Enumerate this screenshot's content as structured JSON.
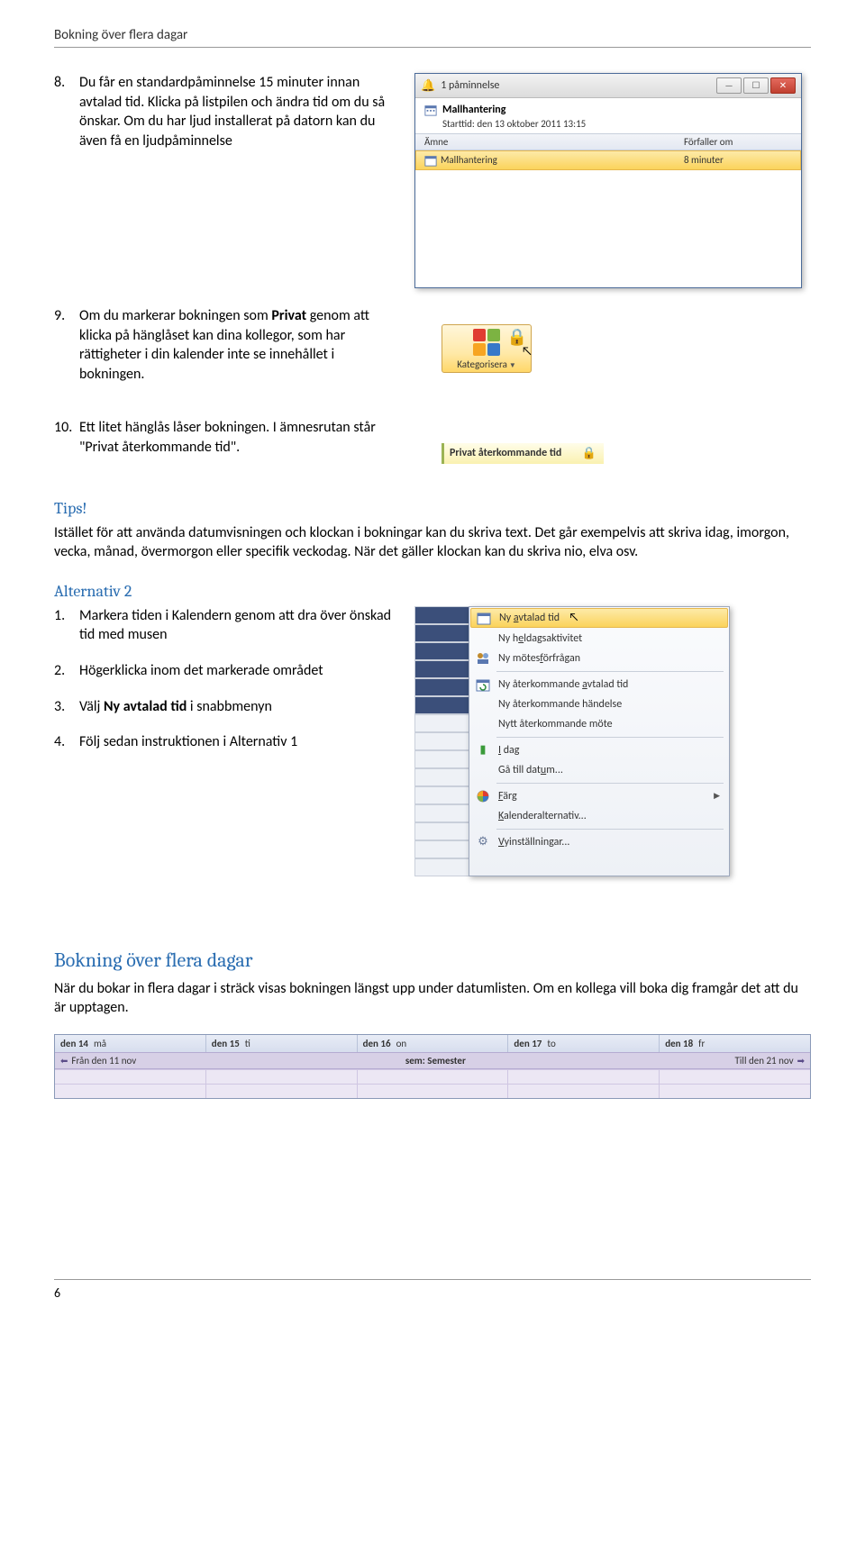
{
  "header": {
    "title": "Bokning över flera dagar"
  },
  "list8": {
    "num": "8.",
    "text_a": "Du får en standardpåminnelse 15 minuter innan avtalad tid. Klicka på listpilen och ändra tid om du så önskar. Om du har ljud installerat på datorn kan du även få en ljudpåminnelse"
  },
  "list9": {
    "num": "9.",
    "before": "Om du markerar bokningen som ",
    "bold": "Privat",
    "after": " genom att klicka på hänglåset kan dina kollegor, som har rättigheter i din kalender inte se innehållet i bokningen."
  },
  "list10": {
    "num": "10.",
    "text": "Ett litet hänglås låser bokningen. I ämnesrutan står \"Privat återkommande tid\"."
  },
  "tips": {
    "heading": "Tips!",
    "body": "Istället för att använda datumvisningen och klockan i bokningar kan du skriva text. Det går exempelvis att skriva idag, imorgon, vecka, månad, övermorgon eller specifik veckodag. När det gäller klockan kan du skriva nio, elva osv."
  },
  "alt2": {
    "heading": "Alternativ 2",
    "i1n": "1.",
    "i1": "Markera tiden i Kalendern genom att dra över önskad tid med musen",
    "i2n": "2.",
    "i2": "Högerklicka inom det markerade området",
    "i3n": "3.",
    "i3a": "Välj ",
    "i3b": "Ny avtalad tid",
    "i3c": " i snabbmenyn",
    "i4n": "4.",
    "i4": "Följ sedan instruktionen i Alternativ 1"
  },
  "section2": {
    "heading": "Bokning över flera dagar",
    "body": "När du bokar in flera dagar i sträck visas bokningen längst upp under datumlisten. Om en kollega vill boka dig framgår det att du är upptagen."
  },
  "reminder": {
    "title": "1 påminnelse",
    "subject": "Mallhantering",
    "starttid": "Starttid: den 13 oktober 2011 13:15",
    "col_amne": "Ämne",
    "col_forfaller": "Förfaller om",
    "row_amne": "Mallhantering",
    "row_forfaller": "8 minuter"
  },
  "categorize": {
    "label": "Kategorisera"
  },
  "priv_subject": {
    "text": "Privat återkommande tid"
  },
  "ctx": {
    "ny_avtalad": "Ny avtalad tid",
    "ny_heldag": "Ny heldagsaktivitet",
    "ny_motes": "Ny mötesförfrågan",
    "ny_aterk_avt": "Ny återkommande avtalad tid",
    "ny_aterk_hand": "Ny återkommande händelse",
    "nytt_aterk_mote": "Nytt återkommande möte",
    "idag": "I dag",
    "ga_till": "Gå till datum...",
    "farg": "Färg",
    "kalenderalt": "Kalenderalternativ...",
    "vyinst": "Vyinställningar..."
  },
  "calbar": {
    "d14": "den 14",
    "w14": "må",
    "d15": "den 15",
    "w15": "ti",
    "d16": "den 16",
    "w16": "on",
    "d17": "den 17",
    "w17": "to",
    "d18": "den 18",
    "w18": "fr",
    "from": "Från den 11 nov",
    "event": "sem: Semester",
    "to": "Till den 21 nov"
  },
  "footer": {
    "page": "6"
  }
}
